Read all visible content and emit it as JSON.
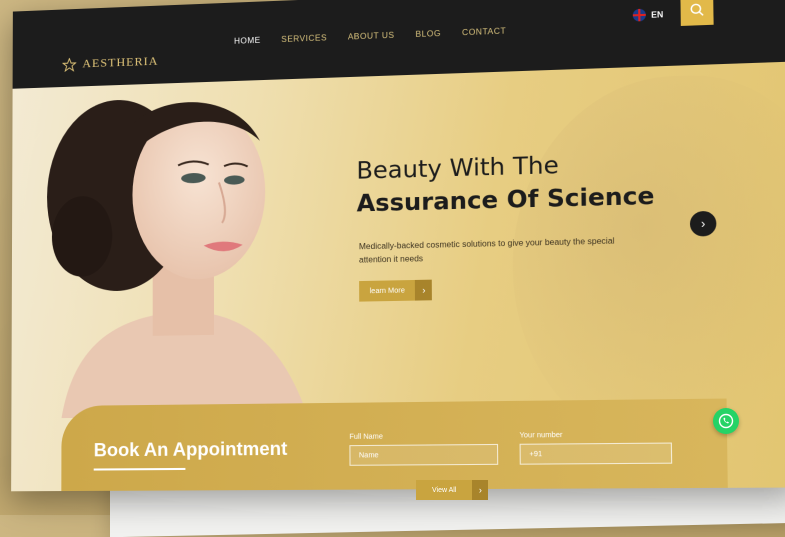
{
  "brand": {
    "name": "AESTHERIA"
  },
  "nav": {
    "items": [
      {
        "label": "HOME",
        "active": true
      },
      {
        "label": "SERVICES",
        "active": false
      },
      {
        "label": "ABOUT US",
        "active": false
      },
      {
        "label": "BLOG",
        "active": false
      },
      {
        "label": "CONTACT",
        "active": false
      }
    ],
    "language": "EN"
  },
  "hero": {
    "title_line1": "Beauty With The",
    "title_line2": "Assurance Of Science",
    "subtitle": "Medically-backed cosmetic solutions to give your beauty the special attention it needs",
    "cta": "learn More"
  },
  "booking": {
    "title": "Book An Appointment",
    "fields": [
      {
        "label": "Full Name",
        "placeholder": "Name"
      },
      {
        "label": "Your number",
        "placeholder": "+91"
      }
    ],
    "view_all": "View All"
  },
  "icons": {
    "search": "search-icon",
    "next": "chevron-right-icon",
    "whatsapp": "whatsapp-icon",
    "flag": "uk-flag-icon"
  },
  "colors": {
    "accent": "#e2b949",
    "nav_bg": "#1c1c1c",
    "gold_button": "#c9a43f",
    "whatsapp": "#25d366"
  }
}
